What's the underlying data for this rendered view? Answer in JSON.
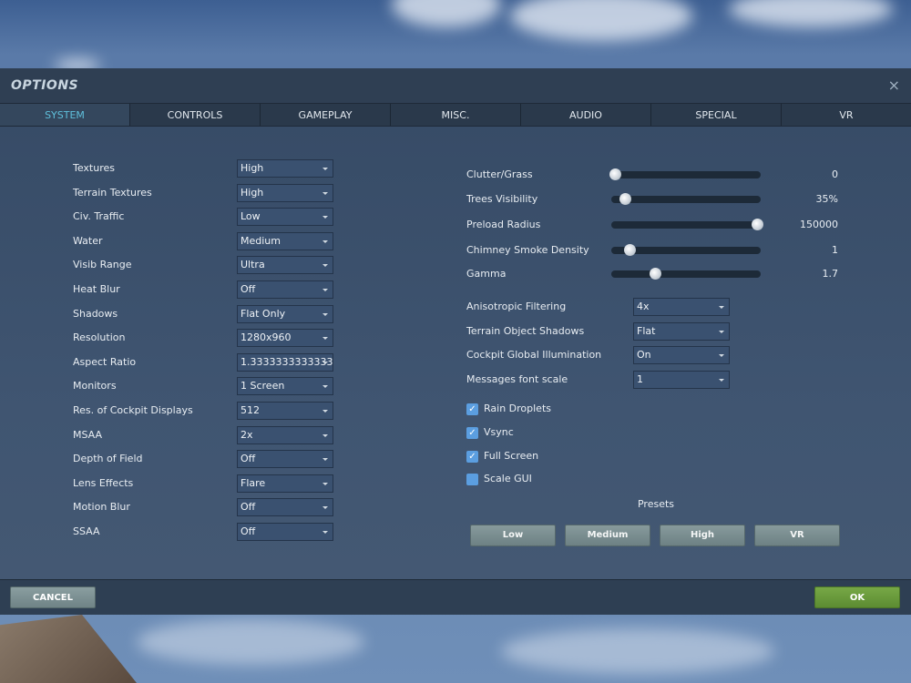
{
  "window": {
    "title": "OPTIONS",
    "close_icon": "×"
  },
  "tabs": [
    "SYSTEM",
    "CONTROLS",
    "GAMEPLAY",
    "MISC.",
    "AUDIO",
    "SPECIAL",
    "VR"
  ],
  "left_settings": [
    {
      "label": "Textures",
      "value": "High"
    },
    {
      "label": "Terrain Textures",
      "value": "High"
    },
    {
      "label": "Civ. Traffic",
      "value": "Low"
    },
    {
      "label": "Water",
      "value": "Medium"
    },
    {
      "label": "Visib Range",
      "value": "Ultra"
    },
    {
      "label": "Heat Blur",
      "value": "Off"
    },
    {
      "label": "Shadows",
      "value": "Flat Only"
    },
    {
      "label": "Resolution",
      "value": "1280x960"
    },
    {
      "label": "Aspect Ratio",
      "value": "1.3333333333333"
    },
    {
      "label": "Monitors",
      "value": "1 Screen"
    },
    {
      "label": "Res. of Cockpit Displays",
      "value": "512"
    },
    {
      "label": "MSAA",
      "value": "2x"
    },
    {
      "label": "Depth of Field",
      "value": "Off"
    },
    {
      "label": "Lens Effects",
      "value": "Flare"
    },
    {
      "label": "Motion Blur",
      "value": "Off"
    },
    {
      "label": "SSAA",
      "value": "Off"
    }
  ],
  "sliders": [
    {
      "label": "Clutter/Grass",
      "value": "0",
      "fraction": 0.0
    },
    {
      "label": "Trees Visibility",
      "value": "35%",
      "fraction": 0.07
    },
    {
      "label": "Preload Radius",
      "value": "150000",
      "fraction": 1.0
    },
    {
      "label": "Chimney Smoke Density",
      "value": "1",
      "fraction": 0.1
    },
    {
      "label": "Gamma",
      "value": "1.7",
      "fraction": 0.28
    }
  ],
  "right_settings": [
    {
      "label": "Anisotropic Filtering",
      "value": "4x"
    },
    {
      "label": "Terrain Object Shadows",
      "value": "Flat"
    },
    {
      "label": "Cockpit Global Illumination",
      "value": "On"
    },
    {
      "label": "Messages font scale",
      "value": "1"
    }
  ],
  "checkboxes": [
    {
      "label": "Rain Droplets",
      "checked": true
    },
    {
      "label": "Vsync",
      "checked": true
    },
    {
      "label": "Full Screen",
      "checked": true
    },
    {
      "label": "Scale GUI",
      "checked": false
    }
  ],
  "presets": {
    "title": "Presets",
    "buttons": [
      "Low",
      "Medium",
      "High",
      "VR"
    ]
  },
  "footer": {
    "cancel": "CANCEL",
    "ok": "OK"
  },
  "colors": {
    "accent_tab": "#5fc0dc",
    "ok_button": "#6a9a3c",
    "checkbox": "#5b9ee0"
  }
}
